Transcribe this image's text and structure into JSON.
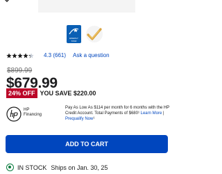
{
  "product": {
    "rating": "4.3",
    "review_count": "(661)",
    "rating_stars": 4.3,
    "ask_question": "Ask a question",
    "was_price": "$899.99",
    "price": "$679.99",
    "discount_badge": "24% OFF",
    "savings_text": "YOU SAVE $220.00",
    "energy_star_label": "ENERGY STAR"
  },
  "financing": {
    "brand_line1": "HP",
    "brand_line2": "Financing",
    "text": "Pay As Low As $114 per month for 6 months with the HP Credit Account. Total Payments of $680¹",
    "learn_more": "Learn More",
    "separator": "|",
    "prequalify": "Prequalify Now",
    "prequalify_suffix": "¹"
  },
  "actions": {
    "add_to_cart": "ADD TO CART"
  },
  "fulfillment": {
    "status": "IN STOCK",
    "ships": "Ships on Jan. 30, 25"
  },
  "colors": {
    "accent_blue": "#0046be",
    "sale_red": "#bb0628",
    "in_stock_green": "#0a7c3e"
  }
}
